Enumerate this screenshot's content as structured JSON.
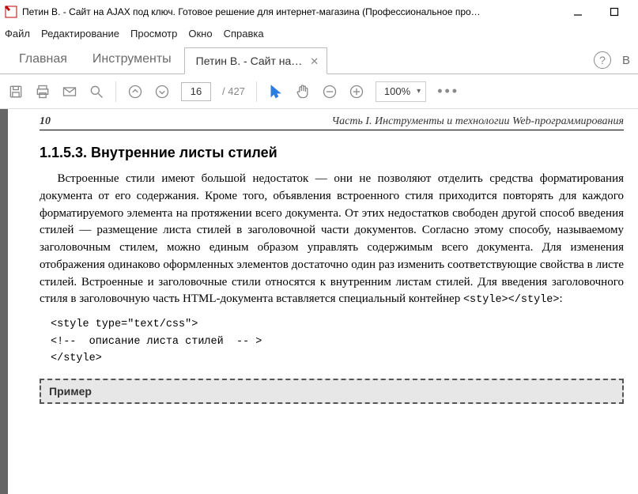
{
  "window": {
    "title": "Петин В. - Сайт на AJAX под ключ. Готовое решение для интернет-магазина (Профессиональное про…"
  },
  "menu": {
    "file": "Файл",
    "edit": "Редактирование",
    "view": "Просмотр",
    "window": "Окно",
    "help": "Справка"
  },
  "tabs": {
    "home": "Главная",
    "tools": "Инструменты",
    "doc_label": "Петин В. - Сайт на…",
    "signin_stub": "В"
  },
  "toolbar": {
    "page_current": "16",
    "page_total": "/ 427",
    "zoom_label": "100%"
  },
  "doc": {
    "page_num": "10",
    "running_title": "Часть I. Инструменты и технологии Web-программирования",
    "heading": "1.1.5.3. Внутренние листы стилей",
    "para1_a": "Встроенные стили имеют большой недостаток — они не позволяют отделить средства форматирования документа от его содержания. Кроме того, объявления встроенного стиля приходится повторять для каждого форматируемого элемента на протяжении всего документа. От этих недостатков свободен другой способ введения стилей — размещение листа стилей в заголовочной части документов. Согласно этому способу, называемому заголовочным стилем, можно единым образом управлять содержимым всего документа. Для изменения отображения одинаково оформленных элементов достаточно один раз изменить соответствующие свойства в листе стилей. Встроенные и заголовочные стили относятся к внутренним листам стилей. Для введения заголовочного стиля в заголовочную часть HTML-документа вставляется специальный контейнер ",
    "para1_code": "<style></style>",
    "para1_b": ":",
    "code_l1": "<style type=\"text/css\">",
    "code_l2": "<!--  описание листа стилей  -- >",
    "code_l3": "</style>",
    "example_label": "Пример"
  }
}
